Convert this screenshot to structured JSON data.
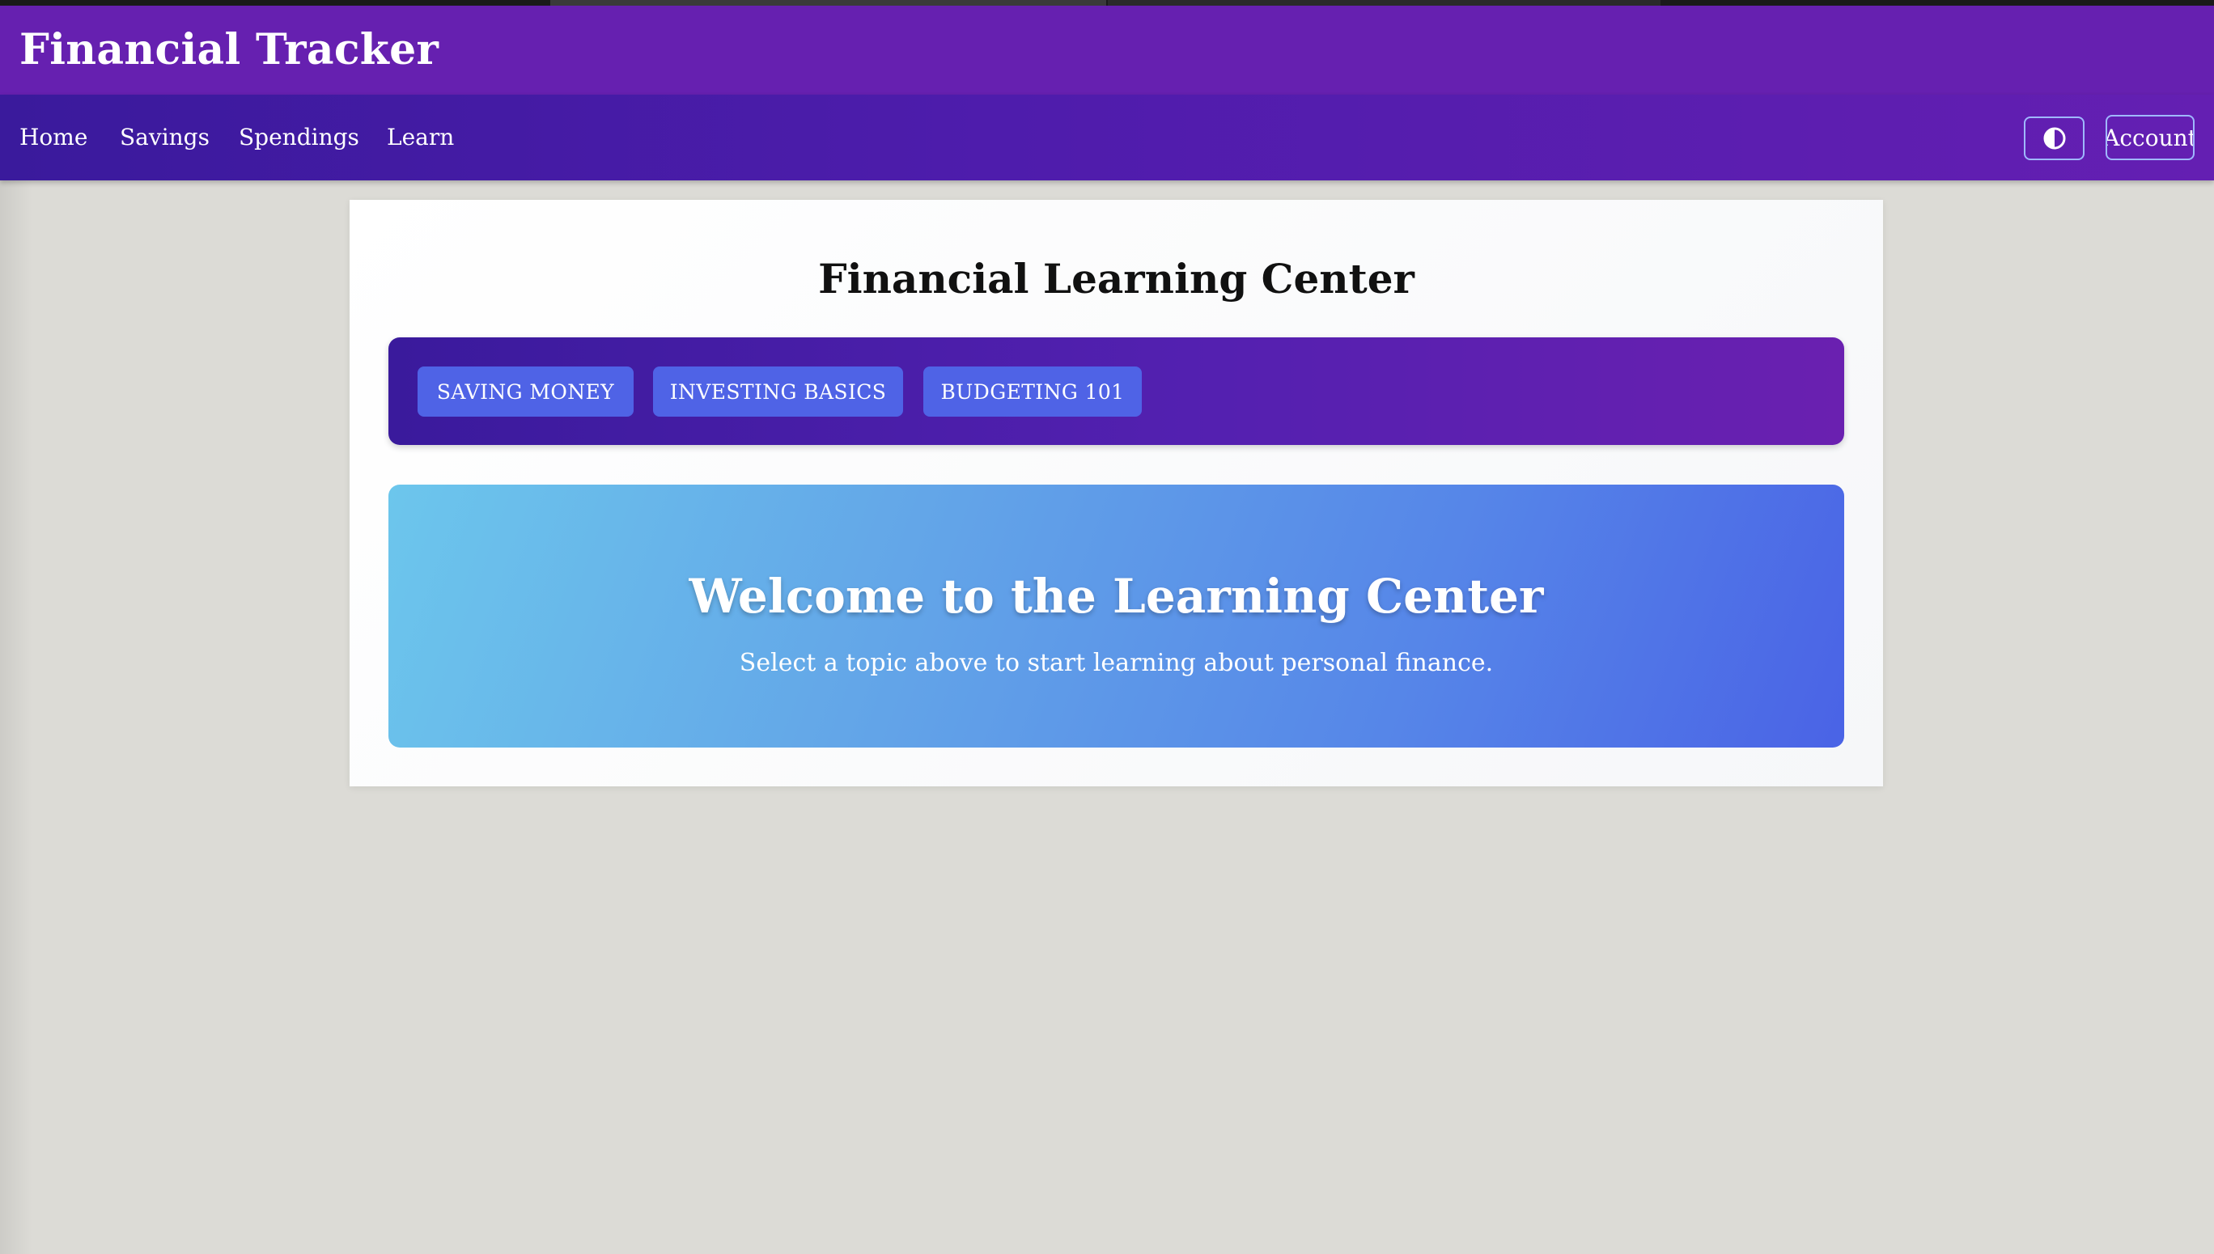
{
  "app": {
    "title": "Financial Tracker"
  },
  "nav": {
    "links": [
      "Home",
      "Savings",
      "Spendings",
      "Learn"
    ],
    "theme_toggle_icon": "contrast-icon",
    "account_label": "Account"
  },
  "learning_center": {
    "title": "Financial Learning Center",
    "topics": [
      "SAVING MONEY",
      "INVESTING BASICS",
      "BUDGETING 101"
    ],
    "welcome": {
      "title": "Welcome to the Learning Center",
      "subtitle": "Select a topic above to start learning about personal finance."
    }
  },
  "colors": {
    "title_bar": "#6620b0",
    "nav_bar_start": "#3a1a9c",
    "nav_bar_end": "#641fb2",
    "topic_button": "#4f63e6",
    "welcome_start": "#6cc6ec",
    "welcome_end": "#4a63e6",
    "page_background": "#dcdbd6"
  }
}
